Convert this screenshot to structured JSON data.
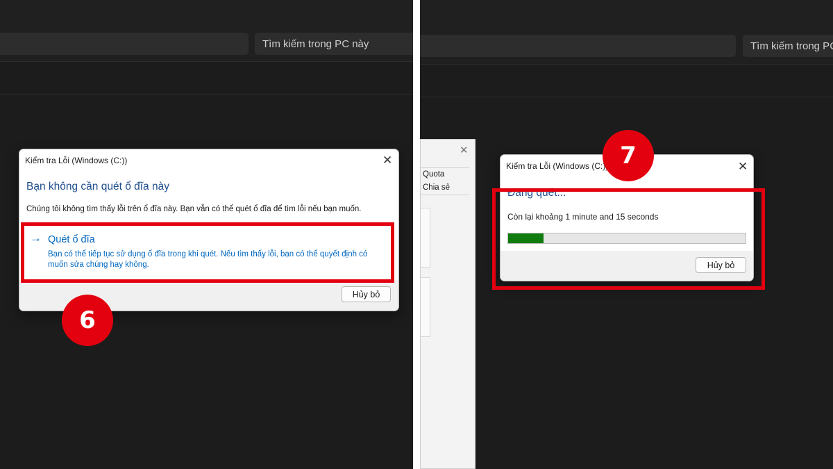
{
  "left": {
    "search_placeholder": "Tìm kiếm trong PC này",
    "dialog": {
      "title": "Kiểm tra Lỗi (Windows (C:))",
      "heading": "Bạn không cần quét ổ đĩa này",
      "description": "Chúng tôi không tìm thấy lỗi trên ổ đĩa này. Bạn vẫn có thể quét ổ đĩa để tìm lỗi nếu bạn muốn.",
      "option_title": "Quét ổ đĩa",
      "option_desc": "Bạn có thể tiếp tục sử dụng ổ đĩa trong khi quét. Nếu tìm thấy lỗi, bạn có thể quyết định có muốn sửa chúng hay không.",
      "cancel": "Hủy bỏ"
    },
    "step_badge": "6"
  },
  "right": {
    "search_placeholder": "Tìm kiếm trong PC này",
    "bg_window": {
      "items": [
        "Quota",
        "Chia sẻ"
      ]
    },
    "dialog": {
      "title": "Kiểm tra Lỗi (Windows (C:))",
      "heading": "Đang quét...",
      "time_remaining": "Còn lại khoảng 1 minute and 15 seconds",
      "progress": 0.15,
      "progress_color": "#107c10",
      "cancel": "Hủy bỏ"
    },
    "step_badge": "7"
  },
  "colors": {
    "highlight": "#e3000f",
    "link": "#0067c0",
    "heading": "#1f4e8c"
  },
  "icons": {
    "close": "close-icon",
    "arrow": "arrow-right-icon"
  }
}
